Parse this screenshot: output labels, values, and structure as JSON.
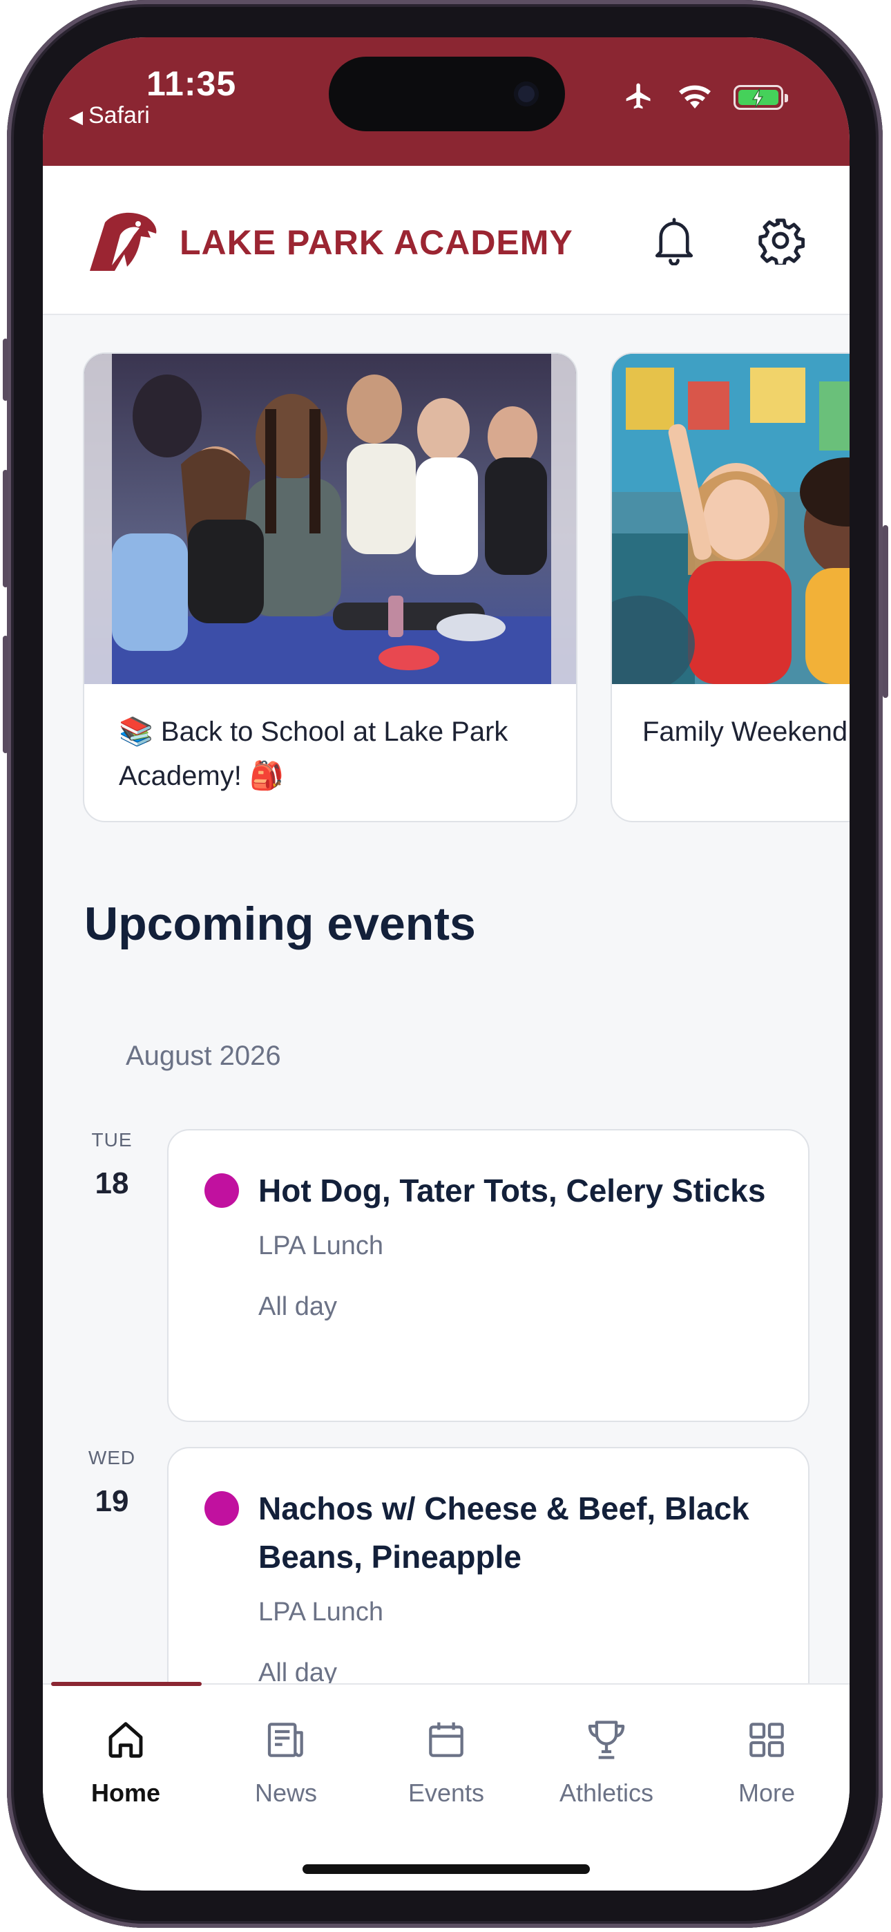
{
  "status_bar": {
    "time": "11:35",
    "back_app": "Safari",
    "icons": [
      "airplane-icon",
      "wifi-icon",
      "battery-charging-icon"
    ]
  },
  "header": {
    "brand": "LAKE PARK ACADEMY",
    "logo": "eagle-logo",
    "icons": [
      "bell-icon",
      "gear-icon"
    ]
  },
  "carousel": {
    "cards": [
      {
        "caption": "📚 Back to School at Lake Park Academy! 🎒",
        "image": "students-sitting-photo"
      },
      {
        "caption": "Family Weekend",
        "image": "kids-raising-hands-photo"
      }
    ]
  },
  "events": {
    "title": "Upcoming events",
    "month": "August 2026",
    "items": [
      {
        "weekday": "TUE",
        "day": "18",
        "title": "Hot Dog, Tater Tots, Celery Sticks",
        "calendar": "LPA Lunch",
        "time": "All day",
        "color": "#c1119f"
      },
      {
        "weekday": "WED",
        "day": "19",
        "title": "Nachos w/ Cheese & Beef, Black Beans, Pineapple",
        "calendar": "LPA Lunch",
        "time": "All day",
        "color": "#c1119f"
      }
    ]
  },
  "tabbar": {
    "tabs": [
      {
        "label": "Home",
        "icon": "home-icon",
        "active": true
      },
      {
        "label": "News",
        "icon": "news-icon",
        "active": false
      },
      {
        "label": "Events",
        "icon": "calendar-icon",
        "active": false
      },
      {
        "label": "Athletics",
        "icon": "trophy-icon",
        "active": false
      },
      {
        "label": "More",
        "icon": "grid-icon",
        "active": false
      }
    ]
  },
  "colors": {
    "brand": "#8b2632",
    "event_dot": "#c1119f",
    "title_text": "#13203a"
  }
}
